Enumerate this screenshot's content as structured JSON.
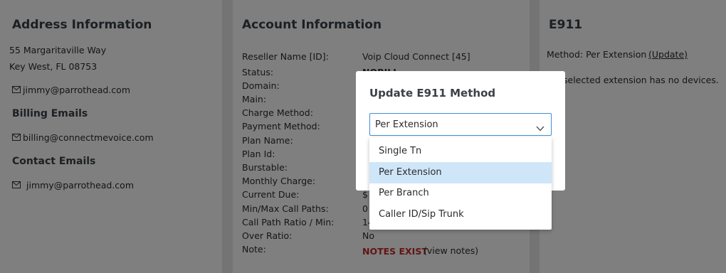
{
  "address": {
    "title": "Address Information",
    "street": "55 Margaritaville Way",
    "city_line": "Key West, FL 08753",
    "email": "jimmy@parrothead.com",
    "billing_title": "Billing Emails",
    "billing_email": "billing@connectmevoice.com",
    "contact_title": "Contact Emails",
    "contact_email": "jimmy@parrothead.com"
  },
  "account": {
    "title": "Account Information",
    "fields": [
      {
        "label": "Reseller Name [ID]:",
        "value": "Voip Cloud Connect [45]"
      },
      {
        "label": "Status:",
        "value": "NOBILL"
      },
      {
        "label": "Domain:",
        "value": ""
      },
      {
        "label": "Main:",
        "value": ""
      },
      {
        "label": "Charge Method:",
        "value": ""
      },
      {
        "label": "Payment Method:",
        "value": ""
      },
      {
        "label": "Plan Name:",
        "value": ""
      },
      {
        "label": "Plan Id:",
        "value": ""
      },
      {
        "label": "Burstable:",
        "value": ""
      },
      {
        "label": "Monthly Charge:",
        "value": ""
      },
      {
        "label": "Current Due:",
        "value": "$"
      },
      {
        "label": "Min/Max Call Paths:",
        "value": "0"
      },
      {
        "label": "Call Path Ratio / Min:",
        "value": "14"
      },
      {
        "label": "Over Ratio:",
        "value": "No"
      },
      {
        "label": "Note:",
        "value": ""
      }
    ],
    "notes_label": "NOTES EXIST",
    "view_notes": "(view notes)"
  },
  "e911": {
    "title": "E911",
    "method_label": "Method: Per Extension",
    "update_link": "(Update)",
    "message": "selected extension has no devices."
  },
  "modal": {
    "title": "Update E911 Method",
    "selected": "Per Extension",
    "options": [
      "Single Tn",
      "Per Extension",
      "Per Branch",
      "Caller ID/Sip Trunk"
    ],
    "highlighted_index": 1
  },
  "colors": {
    "select_border": "#3d8fd6",
    "option_highlight": "#cfe6f9",
    "notes_red": "#c62828",
    "overlay": "rgba(0,0,0,0.5)"
  }
}
